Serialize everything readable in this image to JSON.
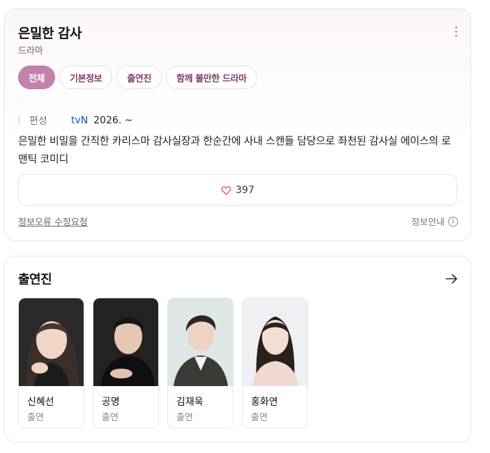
{
  "drama": {
    "title": "은밀한 감사",
    "genre": "드라마"
  },
  "tabs": [
    {
      "label": "전체",
      "active": true
    },
    {
      "label": "기본정보",
      "active": false
    },
    {
      "label": "출연진",
      "active": false
    },
    {
      "label": "함께 볼만한 드라마",
      "active": false
    }
  ],
  "publish": {
    "label": "편성",
    "channel": "tvN",
    "year": "2026. ~"
  },
  "synopsis": "은밀한 비밀을 간직한 카리스마 감사실장과 한순간에 사내 스캔들 담당으로 좌천된 감사실 에이스의 로맨틱 코미디",
  "like_count": "397",
  "links": {
    "report": "정보오류 수정요청",
    "guide": "정보안내",
    "guide_icon": "i"
  },
  "cast_section": {
    "title": "출연진",
    "members": [
      {
        "name": "신혜선",
        "role": "출연"
      },
      {
        "name": "공명",
        "role": "출연"
      },
      {
        "name": "김재욱",
        "role": "출연"
      },
      {
        "name": "홍화연",
        "role": "출연"
      }
    ]
  },
  "colors": {
    "accent": "#c381ad",
    "genre": "#8a4f7d",
    "channel": "#1f4fa8",
    "heart": "#d6495a"
  },
  "icons": [
    "more-vertical-icon",
    "heart-icon",
    "info-icon",
    "arrow-right-icon"
  ]
}
